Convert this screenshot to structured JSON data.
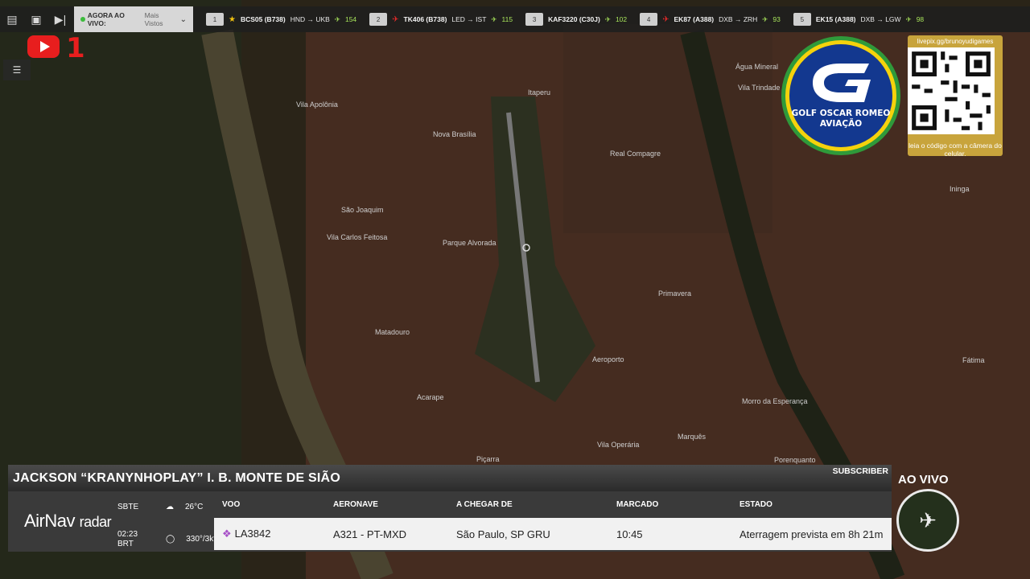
{
  "topbar": {
    "live_label": "AGORA AO VIVO:",
    "live_mode": "Mais Vistos",
    "flights": [
      {
        "rank": "1",
        "callsign": "BCS05 (B738)",
        "route": "HND → UKB",
        "count": "154",
        "marker": "star"
      },
      {
        "rank": "2",
        "callsign": "TK406 (B738)",
        "route": "LED → IST",
        "count": "115",
        "marker": "red-plane"
      },
      {
        "rank": "3",
        "callsign": "KAF3220 (C30J)",
        "route": "",
        "count": "102",
        "marker": ""
      },
      {
        "rank": "4",
        "callsign": "EK87 (A388)",
        "route": "DXB → ZRH",
        "count": "93",
        "marker": "red-plane"
      },
      {
        "rank": "5",
        "callsign": "EK15 (A388)",
        "route": "DXB → LGW",
        "count": "98",
        "marker": ""
      }
    ]
  },
  "overlay": {
    "yt_number": "1",
    "gor_text": "GOLF OSCAR ROMEO\nAVIAÇÃO",
    "qr_url": "livepix.gg/brunoyudigames",
    "qr_caption": "leia o código com a câmera do celular.",
    "ao_vivo": "AO VIVO"
  },
  "panel": {
    "name": "JACKSON “KRANYNHOPLAY” I. B. MONTE DE SIÃO",
    "subscriber": "SUBSCRIBER",
    "brand": "AirNav",
    "brand_suffix": "radar",
    "airport": "SBTE",
    "time": "02:23 BRT",
    "temp": "26°C",
    "wind": "330°/3kts",
    "columns": [
      "VOO",
      "AERONAVE",
      "A CHEGAR DE",
      "MARCADO",
      "ESTADO"
    ],
    "flight": {
      "voo": "LA3842",
      "aeronave": "A321 - PT-MXD",
      "origem": "São Paulo, SP GRU",
      "marcado": "10:45",
      "estado": "Aterragem prevista em 8h 21m"
    }
  },
  "map_labels": [
    "Itaperu",
    "Vila Apolônia",
    "Nova Brasília",
    "Real Compagre",
    "São Joaquim",
    "Parque Alvorada",
    "Vila Carlos Feitosa",
    "Primavera",
    "Matadouro",
    "Aeroporto",
    "Acarape",
    "Morro da Esperança",
    "Marquês",
    "Vila Operária",
    "Porenquanto",
    "Água Mineral",
    "Vila Trindade",
    "Ininga",
    "Fátima",
    "Piçarra"
  ]
}
